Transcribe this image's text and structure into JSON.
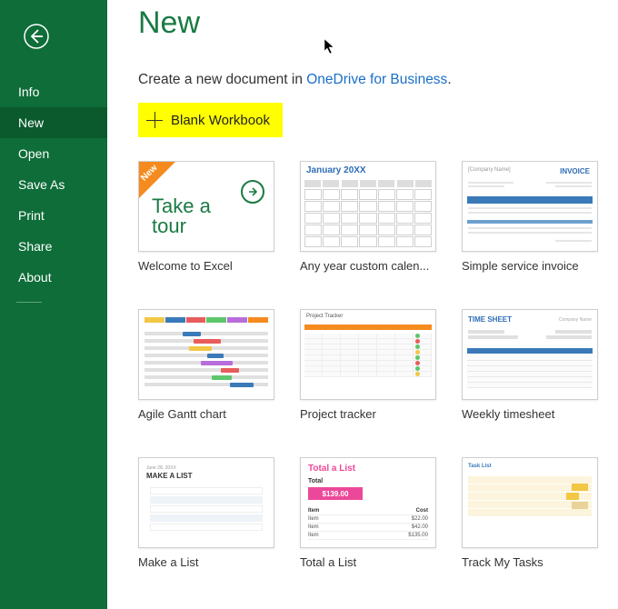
{
  "sidebar": {
    "items": [
      {
        "label": "Info"
      },
      {
        "label": "New"
      },
      {
        "label": "Open"
      },
      {
        "label": "Save As"
      },
      {
        "label": "Print"
      },
      {
        "label": "Share"
      },
      {
        "label": "About"
      }
    ],
    "active_index": 1
  },
  "header": {
    "title": "New",
    "create_prefix": "Create a new document in ",
    "create_link": "OneDrive for Business",
    "create_suffix": "."
  },
  "blank": {
    "label": "Blank Workbook"
  },
  "templates": [
    {
      "label": "Welcome to Excel",
      "thumb": {
        "badge": "New",
        "line1": "Take a",
        "line2": "tour"
      }
    },
    {
      "label": "Any year custom calen...",
      "thumb": {
        "title": "January 20XX"
      }
    },
    {
      "label": "Simple service invoice",
      "thumb": {
        "title": "INVOICE",
        "company": "[Company Name]"
      }
    },
    {
      "label": "Agile Gantt chart",
      "thumb": {}
    },
    {
      "label": "Project tracker",
      "thumb": {
        "title": "Project Tracker"
      }
    },
    {
      "label": "Weekly timesheet",
      "thumb": {
        "title": "TIME SHEET",
        "company": "Company Name"
      }
    },
    {
      "label": "Make a List",
      "thumb": {
        "date": "June 28, 20XX",
        "title": "MAKE A LIST"
      }
    },
    {
      "label": "Total a List",
      "thumb": {
        "title": "Total a List",
        "total_label": "Total",
        "total_value": "$139.00",
        "col_item": "Item",
        "col_cost": "Cost",
        "rows": [
          {
            "item": "Item",
            "cost": "$22.00"
          },
          {
            "item": "Item",
            "cost": "$42.00"
          },
          {
            "item": "Item",
            "cost": "$135.00"
          }
        ]
      }
    },
    {
      "label": "Track My Tasks",
      "thumb": {
        "title": "Task List"
      }
    }
  ],
  "colors": {
    "sidebar_bg": "#0e6d38",
    "sidebar_active": "#0a5a2e",
    "accent_green": "#1a7a43",
    "link_blue": "#1a6fc7",
    "highlight_yellow": "#ffff00"
  }
}
